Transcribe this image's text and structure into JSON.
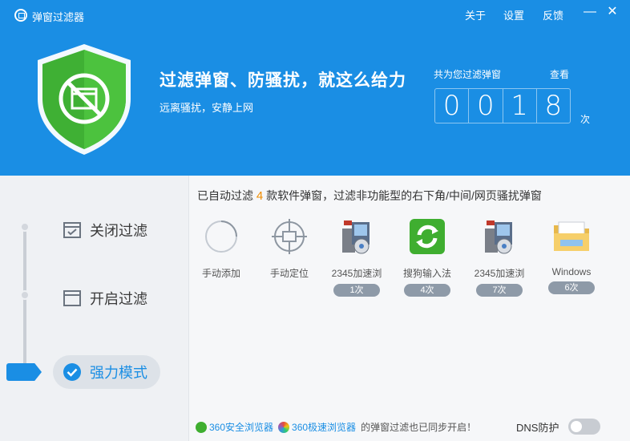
{
  "app": {
    "title": "弹窗过滤器",
    "menu": {
      "about": "关于",
      "settings": "设置",
      "feedback": "反馈"
    },
    "window_controls": {
      "minimize": "—",
      "close": "✕"
    }
  },
  "hero": {
    "slogan": "过滤弹窗、防骚扰，就这么给力",
    "subslogan": "远离骚扰，安静上网",
    "counter_label": "共为您过滤弹窗",
    "view_link": "查看",
    "digits": [
      "0",
      "0",
      "1",
      "8"
    ],
    "unit": "次"
  },
  "modes": {
    "items": [
      {
        "label": "关闭过滤",
        "icon": "check-window-icon"
      },
      {
        "label": "开启过滤",
        "icon": "window-icon"
      },
      {
        "label": "强力模式",
        "icon": "check-circle-icon"
      }
    ],
    "active": "强力模式"
  },
  "main": {
    "summary_prefix": "已自动过滤",
    "summary_count": "4",
    "summary_suffix": "款软件弹窗，过滤非功能型的右下角/中间/网页骚扰弹窗",
    "actions": [
      {
        "label": "手动添加",
        "icon": "loading-circle-icon"
      },
      {
        "label": "手动定位",
        "icon": "crosshair-icon"
      }
    ],
    "apps": [
      {
        "label": "2345加速浏",
        "count": "1次",
        "icon": "installer-icon"
      },
      {
        "label": "搜狗输入法",
        "count": "4次",
        "icon": "sogou-icon"
      },
      {
        "label": "2345加速浏",
        "count": "7次",
        "icon": "installer-icon"
      },
      {
        "label": "Windows",
        "count": "6次",
        "icon": "folder-icon"
      }
    ]
  },
  "footer": {
    "browser1": "360安全浏览器",
    "browser2": "360极速浏览器",
    "note": "的弹窗过滤也已同步开启！",
    "dns_label": "DNS防护",
    "dns_enabled": false
  },
  "colors": {
    "accent": "#1a8ee4",
    "shield_green": "#3fb034",
    "count_orange": "#f08c00"
  }
}
